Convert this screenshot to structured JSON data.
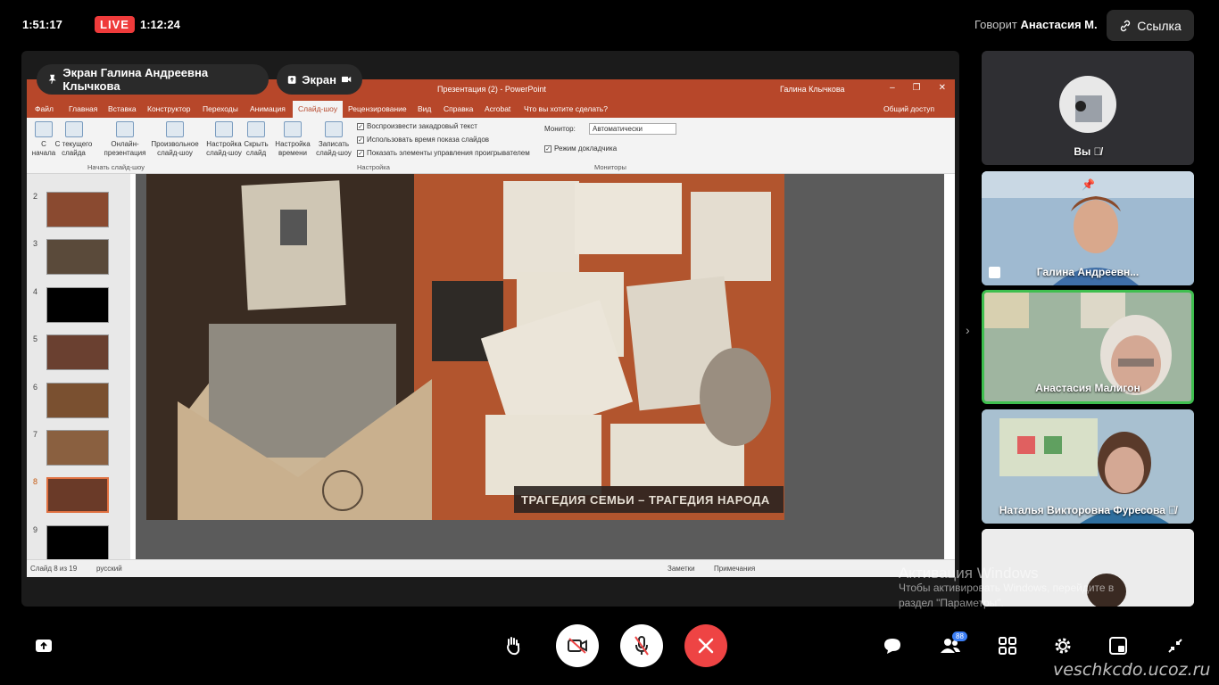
{
  "topbar": {
    "clock": "1:51:17",
    "live": "LIVE",
    "duration": "1:12:24",
    "speaking_prefix": "Говорит",
    "speaking_name": "Анастасия М.",
    "link_label": "Ссылка"
  },
  "stage": {
    "pill_screen_owner": "Экран Галина Андреевна Клычкова",
    "pill_screen": "Экран"
  },
  "ppt": {
    "title": "Презентация (2)  -  PowerPoint",
    "user": "Галина Клычкова",
    "tabs": [
      "Файл",
      "Главная",
      "Вставка",
      "Конструктор",
      "Переходы",
      "Анимация",
      "Слайд-шоу",
      "Рецензирование",
      "Вид",
      "Справка",
      "Acrobat",
      "Что вы хотите сделать?"
    ],
    "active_tab": "Слайд-шоу",
    "share": "Общий доступ",
    "ribbon": {
      "from_start": "С начала",
      "from_current": "С текущего слайда",
      "online": "Онлайн-презентация",
      "custom": "Произвольное слайд-шоу",
      "group_start": "Начать слайд-шоу",
      "setup": "Настройка слайд-шоу",
      "hide": "Скрыть слайд",
      "rehearse": "Настройка времени",
      "record": "Записать слайд-шоу",
      "check1": "Воспроизвести закадровый текст",
      "check2": "Использовать время показа слайдов",
      "check3": "Показать элементы управления проигрывателем",
      "group_setup": "Настройка",
      "monitor_label": "Монитор:",
      "monitor_value": "Автоматически",
      "presenter_view": "Режим докладчика",
      "group_monitors": "Мониторы"
    },
    "thumb_numbers": [
      "2",
      "3",
      "4",
      "5",
      "6",
      "7",
      "8",
      "9"
    ],
    "current_slide": "8",
    "slide_caption": "ТРАГЕДИЯ СЕМЬИ – ТРАГЕДИЯ НАРОДА",
    "status_slide": "Слайд 8 из 19",
    "status_lang": "русский",
    "status_notes": "Заметки",
    "status_comments": "Примечания"
  },
  "gallery": [
    {
      "name": "Вы",
      "muted": true
    },
    {
      "name": "Галина Андреевн...",
      "pinned": true
    },
    {
      "name": "Анастасия Малигон",
      "active": true
    },
    {
      "name": "Наталья Викторовна Фуресова",
      "muted": true
    },
    {
      "name": ""
    }
  ],
  "activation": {
    "title": "Активация Windows",
    "line1": "Чтобы активировать Windows, перейдите в",
    "line2": "раздел \"Параметры\"."
  },
  "controls": {
    "participants_count": "88"
  },
  "watermark": "veschkcdo.ucoz.ru",
  "colors": {
    "live": "#ef3b3b",
    "ppt_accent": "#b7472a",
    "active_speaker": "#3fbf4f",
    "end_call": "#ee4444",
    "badge": "#3b7ef5"
  }
}
